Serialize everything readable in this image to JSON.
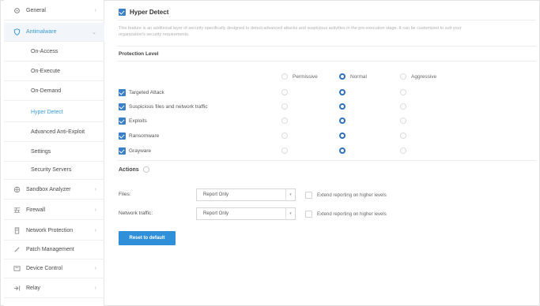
{
  "sidebar": {
    "items": [
      {
        "label": "General",
        "icon": "gear-icon",
        "chevron": "›"
      },
      {
        "label": "Antimalware",
        "icon": "shield-icon",
        "chevron": "⌄"
      },
      {
        "label": "On-Access"
      },
      {
        "label": "On-Execute"
      },
      {
        "label": "On-Demand"
      },
      {
        "label": "Hyper Detect"
      },
      {
        "label": "Advanced Anti-Exploit"
      },
      {
        "label": "Settings"
      },
      {
        "label": "Security Servers"
      },
      {
        "label": "Sandbox Analyzer",
        "icon": "sandbox-icon",
        "chevron": "›"
      },
      {
        "label": "Firewall",
        "icon": "firewall-icon",
        "chevron": "›"
      },
      {
        "label": "Network Protection",
        "icon": "network-icon",
        "chevron": "›"
      },
      {
        "label": "Patch Management",
        "icon": "patch-icon"
      },
      {
        "label": "Device Control",
        "icon": "device-icon",
        "chevron": "›"
      },
      {
        "label": "Relay",
        "icon": "relay-icon",
        "chevron": "›"
      }
    ]
  },
  "main": {
    "title": "Hyper Detect",
    "enabled": true,
    "description": "This feature is an additional layer of security specifically designed to detect advanced attacks and suspicious activities in the pre-execution stage. It can be customized to suit your organization's security requirements.",
    "protection_level": {
      "title": "Protection Level",
      "levels": [
        "Permissive",
        "Normal",
        "Aggressive"
      ],
      "selected_level": "Normal",
      "rows": [
        {
          "label": "Targeted Attack",
          "checked": true,
          "level": "Normal"
        },
        {
          "label": "Suspicious files and network traffic",
          "checked": true,
          "level": "Normal"
        },
        {
          "label": "Exploits",
          "checked": true,
          "level": "Normal"
        },
        {
          "label": "Ransomware",
          "checked": true,
          "level": "Normal"
        },
        {
          "label": "Grayware",
          "checked": true,
          "level": "Normal"
        }
      ]
    },
    "actions": {
      "title": "Actions",
      "rows": [
        {
          "label": "Files:",
          "value": "Report Only",
          "extend_label": "Extend reporting on higher levels",
          "extend_checked": false
        },
        {
          "label": "Network traffic:",
          "value": "Report Only",
          "extend_label": "Extend reporting on higher levels",
          "extend_checked": false
        }
      ]
    },
    "reset_label": "Reset to default"
  },
  "colors": {
    "accent": "#2f8fd8",
    "checkbox": "#3a7fc8",
    "active_nav": "#3a9ad9"
  }
}
